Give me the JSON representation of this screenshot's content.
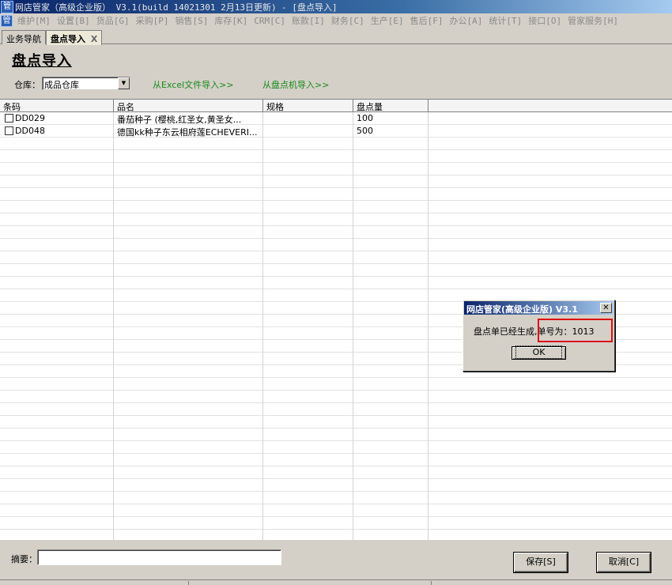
{
  "window": {
    "icon": "app-icon",
    "title": "网店管家（高级企业版） V3.1(build 14021301 2月13日更新) - [盘点导入]"
  },
  "menu": [
    "维护[M]",
    "设置[B]",
    "货品[G]",
    "采购[P]",
    "销售[S]",
    "库存[K]",
    "CRM[C]",
    "账款[I]",
    "财务[C]",
    "生产[E]",
    "售后[F]",
    "办公[A]",
    "统计[T]",
    "接口[O]",
    "管家服务[H]"
  ],
  "tabs": {
    "nav": "业务导航",
    "active": "盘点导入",
    "close": "X"
  },
  "page": {
    "title": "盘点导入",
    "warehouse_label": "仓库：",
    "warehouse_value": "成品仓库",
    "link_excel": "从Excel文件导入>>",
    "link_scanner": "从盘点机导入>>"
  },
  "table": {
    "columns": [
      "条码",
      "品名",
      "规格",
      "盘点量"
    ],
    "rows": [
      {
        "code": "DD029",
        "name": "番茄种子 (樱桃,红圣女,黄圣女...",
        "spec": "",
        "qty": "100"
      },
      {
        "code": "DD048",
        "name": "德国kk种子东云相府莲ECHEVERI...",
        "spec": "",
        "qty": "500"
      }
    ]
  },
  "footer": {
    "summary_label": "摘要：",
    "summary_value": "",
    "save_label": "保存[S]",
    "cancel_label": "取消[C]"
  },
  "dialog": {
    "title": "网店管家(高级企业版) V3.1",
    "message_prefix": "盘点单已经生成,",
    "message_number": "单号为：1013",
    "ok_label": "OK",
    "close": "✕"
  },
  "colors": {
    "link": "#188a18",
    "highlight_border": "#e01010",
    "title_gradient_start": "#0a246a"
  }
}
